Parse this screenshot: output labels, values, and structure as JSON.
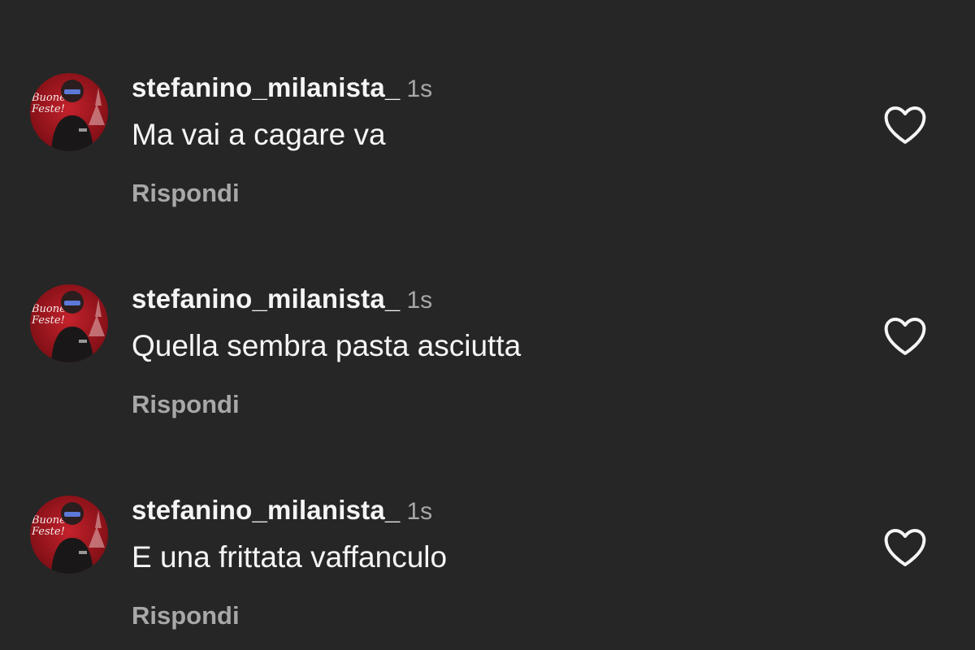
{
  "colors": {
    "background": "#262626",
    "primary_text": "#f5f5f5",
    "secondary_text": "#a8a8a8"
  },
  "comments": [
    {
      "username": "stefanino_milanista_",
      "time": "1s",
      "text": "Ma vai a cagare va",
      "reply_label": "Rispondi",
      "avatar_text": [
        "Buone",
        "Feste!"
      ],
      "like_icon": "heart-outline-icon"
    },
    {
      "username": "stefanino_milanista_",
      "time": "1s",
      "text": "Quella sembra pasta asciutta",
      "reply_label": "Rispondi",
      "avatar_text": [
        "Buone",
        "Feste!"
      ],
      "like_icon": "heart-outline-icon"
    },
    {
      "username": "stefanino_milanista_",
      "time": "1s",
      "text": "E una frittata vaffanculo",
      "reply_label": "Rispondi",
      "avatar_text": [
        "Buone",
        "Feste!"
      ],
      "like_icon": "heart-outline-icon"
    }
  ]
}
